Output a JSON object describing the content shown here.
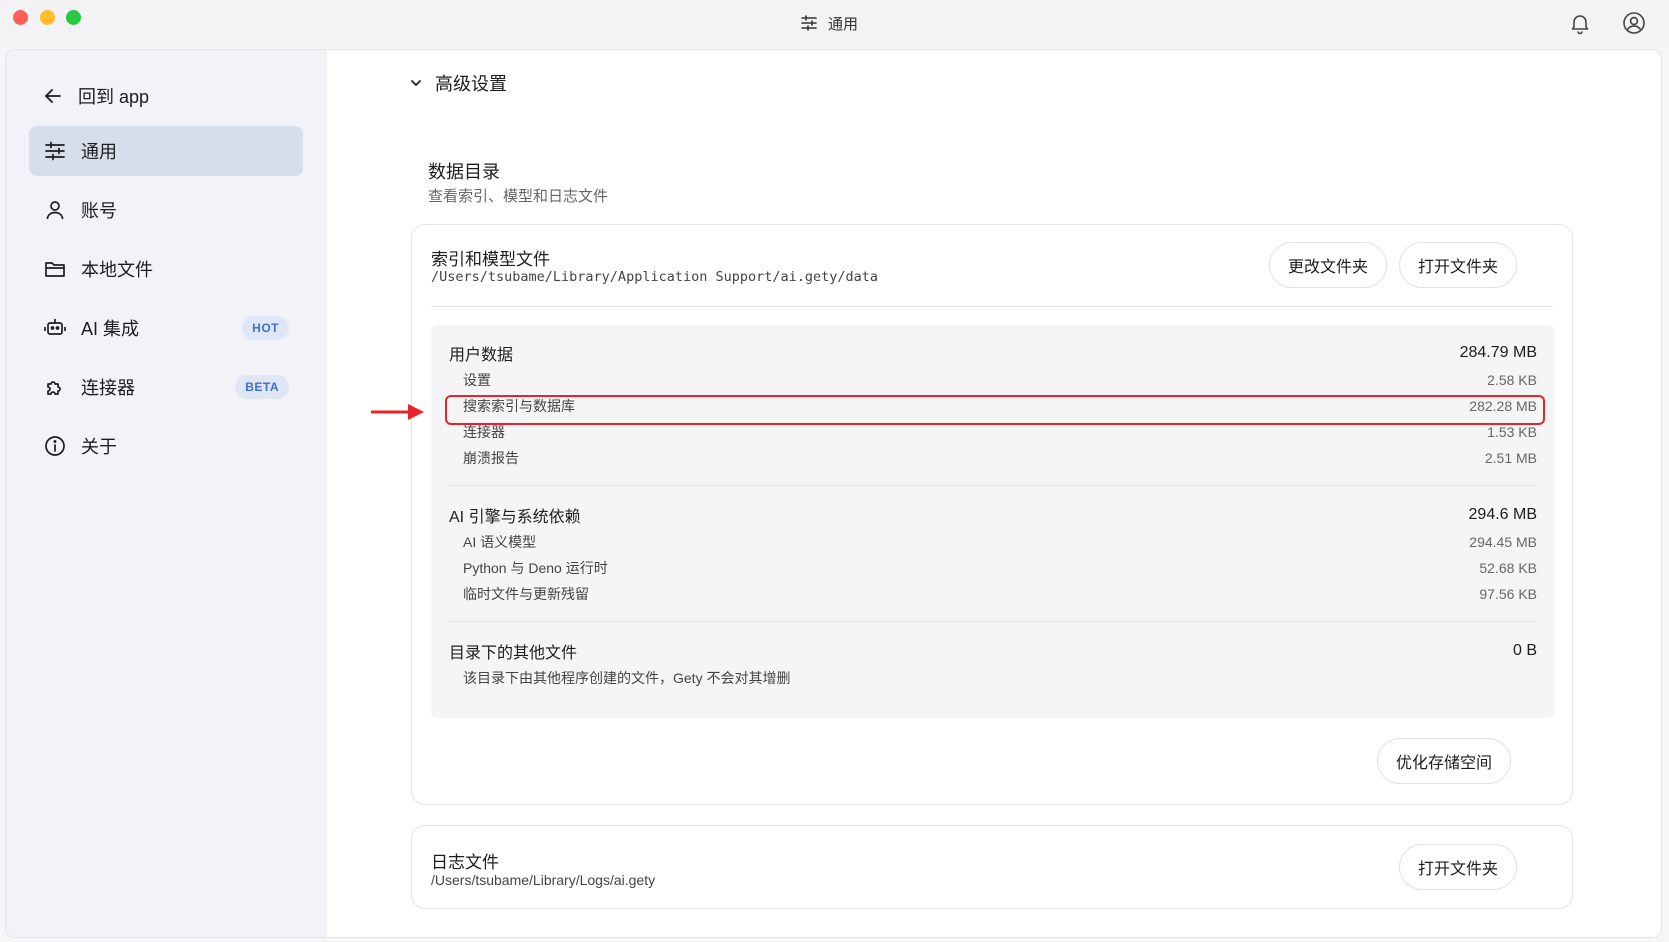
{
  "window": {
    "title": "通用",
    "colors": {
      "accent": "#3b6fd3",
      "highlight": "#e8242b",
      "sidebar_active": "#d6deec"
    }
  },
  "sidebar": {
    "back_label": "回到 app",
    "items": [
      {
        "label": "通用",
        "icon": "sliders-icon",
        "active": true
      },
      {
        "label": "账号",
        "icon": "person-icon"
      },
      {
        "label": "本地文件",
        "icon": "folder-icon"
      },
      {
        "label": "AI 集成",
        "icon": "robot-icon",
        "badge": "HOT"
      },
      {
        "label": "连接器",
        "icon": "puzzle-icon",
        "badge": "BETA"
      },
      {
        "label": "关于",
        "icon": "info-icon"
      }
    ]
  },
  "main": {
    "section_title": "高级设置",
    "data_dir": {
      "title": "数据目录",
      "subtitle": "查看索引、模型和日志文件"
    },
    "index_card": {
      "title": "索引和模型文件",
      "path": "/Users/tsubame/Library/Application Support/ai.gety/data",
      "change_button": "更改文件夹",
      "open_button": "打开文件夹",
      "optimize_button": "优化存储空间",
      "groups": [
        {
          "name": "用户数据",
          "total": "284.79 MB",
          "rows": [
            {
              "label": "设置",
              "value": "2.58 KB"
            },
            {
              "label": "搜索索引与数据库",
              "value": "282.28 MB",
              "highlighted": true
            },
            {
              "label": "连接器",
              "value": "1.53 KB"
            },
            {
              "label": "崩溃报告",
              "value": "2.51 MB"
            }
          ]
        },
        {
          "name": "AI 引擎与系统依赖",
          "total": "294.6 MB",
          "rows": [
            {
              "label": "AI 语义模型",
              "value": "294.45 MB"
            },
            {
              "label": "Python 与 Deno 运行时",
              "value": "52.68 KB"
            },
            {
              "label": "临时文件与更新残留",
              "value": "97.56 KB"
            }
          ]
        },
        {
          "name": "目录下的其他文件",
          "total": "0 B",
          "note": "该目录下由其他程序创建的文件，Gety 不会对其增删"
        }
      ]
    },
    "log_card": {
      "title": "日志文件",
      "path": "/Users/tsubame/Library/Logs/ai.gety",
      "open_button": "打开文件夹"
    }
  }
}
